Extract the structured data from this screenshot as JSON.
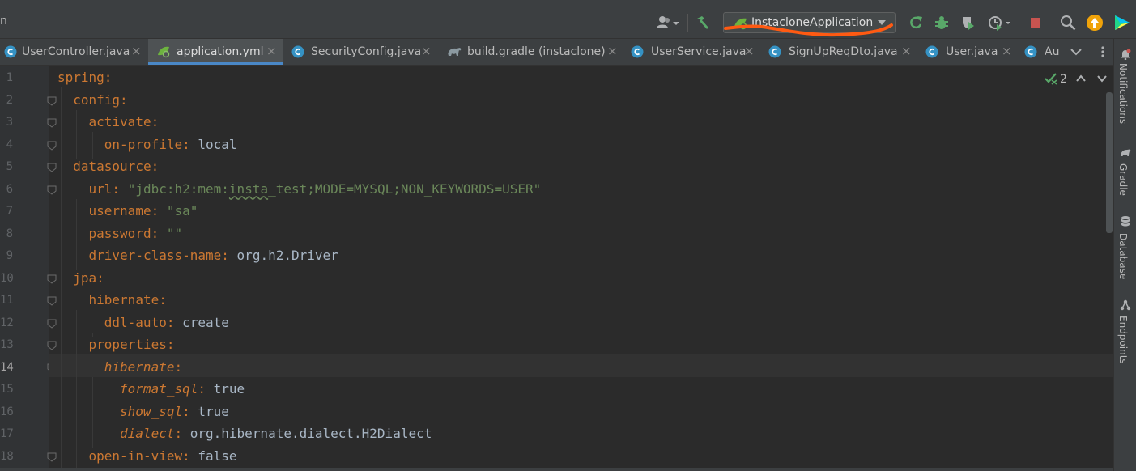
{
  "toolbar": {
    "breadcrumb_fragment": "n",
    "run_configuration": "InstacloneApplication"
  },
  "tabs": [
    {
      "label": "UserController.java",
      "icon": "java-class-icon",
      "active": false
    },
    {
      "label": "application.yml",
      "icon": "spring-yaml-icon",
      "active": true
    },
    {
      "label": "SecurityConfig.java",
      "icon": "java-class-icon",
      "active": false
    },
    {
      "label": "build.gradle (instaclone)",
      "icon": "gradle-icon",
      "active": false
    },
    {
      "label": "UserService.java",
      "icon": "java-class-icon",
      "active": false
    },
    {
      "label": "SignUpReqDto.java",
      "icon": "java-class-icon",
      "active": false
    },
    {
      "label": "User.java",
      "icon": "java-class-icon",
      "active": false
    },
    {
      "label": "Au",
      "icon": "java-class-icon",
      "active": false
    }
  ],
  "tab_close_glyph": "×",
  "editor": {
    "current_line": "14",
    "inspections_count": "2",
    "lines": [
      {
        "num": "1",
        "key": "spring",
        "sep": ":",
        "value": "",
        "vclass": "v"
      },
      {
        "num": "2",
        "key": "config",
        "sep": ":",
        "value": "",
        "vclass": "v"
      },
      {
        "num": "3",
        "key": "activate",
        "sep": ":",
        "value": "",
        "vclass": "v"
      },
      {
        "num": "4",
        "key": "on-profile",
        "sep": ": ",
        "value": "local",
        "vclass": "v"
      },
      {
        "num": "5",
        "key": "datasource",
        "sep": ":",
        "value": "",
        "vclass": "v"
      },
      {
        "num": "6",
        "key": "url",
        "sep": ": ",
        "value": "\"jdbc:h2:mem:insta_test;MODE=MYSQL;NON_KEYWORDS=USER\"",
        "vclass": "s"
      },
      {
        "num": "7",
        "key": "username",
        "sep": ": ",
        "value": "\"sa\"",
        "vclass": "s"
      },
      {
        "num": "8",
        "key": "password",
        "sep": ": ",
        "value": "\"\"",
        "vclass": "s"
      },
      {
        "num": "9",
        "key": "driver-class-name",
        "sep": ": ",
        "value": "org.h2.Driver",
        "vclass": "v"
      },
      {
        "num": "10",
        "key": "jpa",
        "sep": ":",
        "value": "",
        "vclass": "v"
      },
      {
        "num": "11",
        "key": "hibernate",
        "sep": ":",
        "value": "",
        "vclass": "v"
      },
      {
        "num": "12",
        "key": "ddl-auto",
        "sep": ": ",
        "value": "create",
        "vclass": "v"
      },
      {
        "num": "13",
        "key": "properties",
        "sep": ":",
        "value": "",
        "vclass": "v"
      },
      {
        "num": "14",
        "key": "hibernate",
        "sep": ":",
        "value": "",
        "vclass": "v"
      },
      {
        "num": "15",
        "key": "format_sql",
        "sep": ": ",
        "value": "true",
        "vclass": "v"
      },
      {
        "num": "16",
        "key": "show_sql",
        "sep": ": ",
        "value": "true",
        "vclass": "v"
      },
      {
        "num": "17",
        "key": "dialect",
        "sep": ": ",
        "value": "org.hibernate.dialect.H2Dialect",
        "vclass": "v"
      },
      {
        "num": "18",
        "key": "open-in-view",
        "sep": ": ",
        "value": "false",
        "vclass": "v"
      }
    ]
  },
  "tool_windows": [
    {
      "label": "Notifications",
      "icon": "bell-icon"
    },
    {
      "label": "Gradle",
      "icon": "gradle-icon"
    },
    {
      "label": "Database",
      "icon": "database-icon"
    },
    {
      "label": "Endpoints",
      "icon": "endpoints-icon"
    }
  ],
  "colors": {
    "annotation_stroke": "#ff5a12",
    "accent": "#4a88c7",
    "key": "#cc7832",
    "string": "#6a8759",
    "value": "#a9b7c6"
  }
}
